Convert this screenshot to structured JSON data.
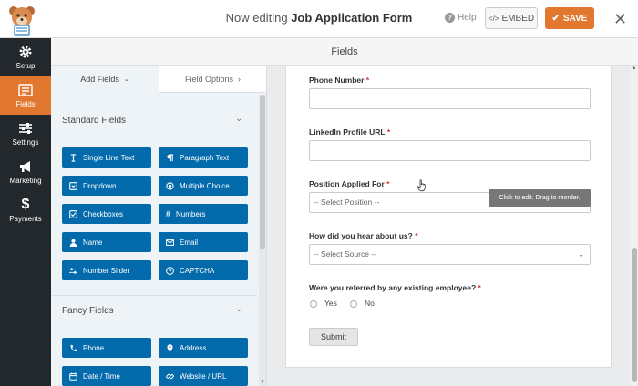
{
  "header": {
    "editing_prefix": "Now editing",
    "form_name": "Job Application Form",
    "help_label": "Help",
    "embed_label": "EMBED",
    "save_label": "SAVE"
  },
  "nav": {
    "items": [
      {
        "label": "Setup",
        "icon": "gear-icon"
      },
      {
        "label": "Fields",
        "icon": "fields-list-icon"
      },
      {
        "label": "Settings",
        "icon": "sliders-icon"
      },
      {
        "label": "Marketing",
        "icon": "megaphone-icon"
      },
      {
        "label": "Payments",
        "icon": "dollar-icon"
      }
    ],
    "active": "Fields"
  },
  "page": {
    "title": "Fields"
  },
  "panel": {
    "tabs": {
      "add_fields": "Add Fields",
      "field_options": "Field Options"
    },
    "standard": {
      "title": "Standard Fields",
      "buttons": [
        {
          "label": "Single Line Text",
          "icon": "text-cursor-icon"
        },
        {
          "label": "Paragraph Text",
          "icon": "paragraph-icon"
        },
        {
          "label": "Dropdown",
          "icon": "dropdown-icon"
        },
        {
          "label": "Multiple Choice",
          "icon": "radio-dot-icon"
        },
        {
          "label": "Checkboxes",
          "icon": "checkbox-icon"
        },
        {
          "label": "Numbers",
          "icon": "hash-icon"
        },
        {
          "label": "Name",
          "icon": "user-icon"
        },
        {
          "label": "Email",
          "icon": "envelope-icon"
        },
        {
          "label": "Number Slider",
          "icon": "slider-icon"
        },
        {
          "label": "CAPTCHA",
          "icon": "question-circle-icon"
        }
      ]
    },
    "fancy": {
      "title": "Fancy Fields",
      "buttons": [
        {
          "label": "Phone",
          "icon": "phone-icon"
        },
        {
          "label": "Address",
          "icon": "map-marker-icon"
        },
        {
          "label": "Date / Time",
          "icon": "calendar-icon"
        },
        {
          "label": "Website / URL",
          "icon": "link-icon"
        }
      ]
    }
  },
  "form": {
    "phone_label": "Phone Number",
    "linkedin_label": "LinkedIn Profile URL",
    "position_label": "Position Applied For",
    "position_placeholder": "-- Select Position --",
    "source_label": "How did you hear about us?",
    "source_placeholder": "-- Select Source --",
    "referral_label": "Were you referred by any existing employee?",
    "referral_options": [
      "Yes",
      "No"
    ],
    "submit_label": "Submit",
    "required_marker": "*"
  },
  "tooltip": "Click to edit. Drag to reorder.",
  "colors": {
    "accent": "#e27730",
    "field_button": "#036aab",
    "nav_bg": "#23282d"
  }
}
